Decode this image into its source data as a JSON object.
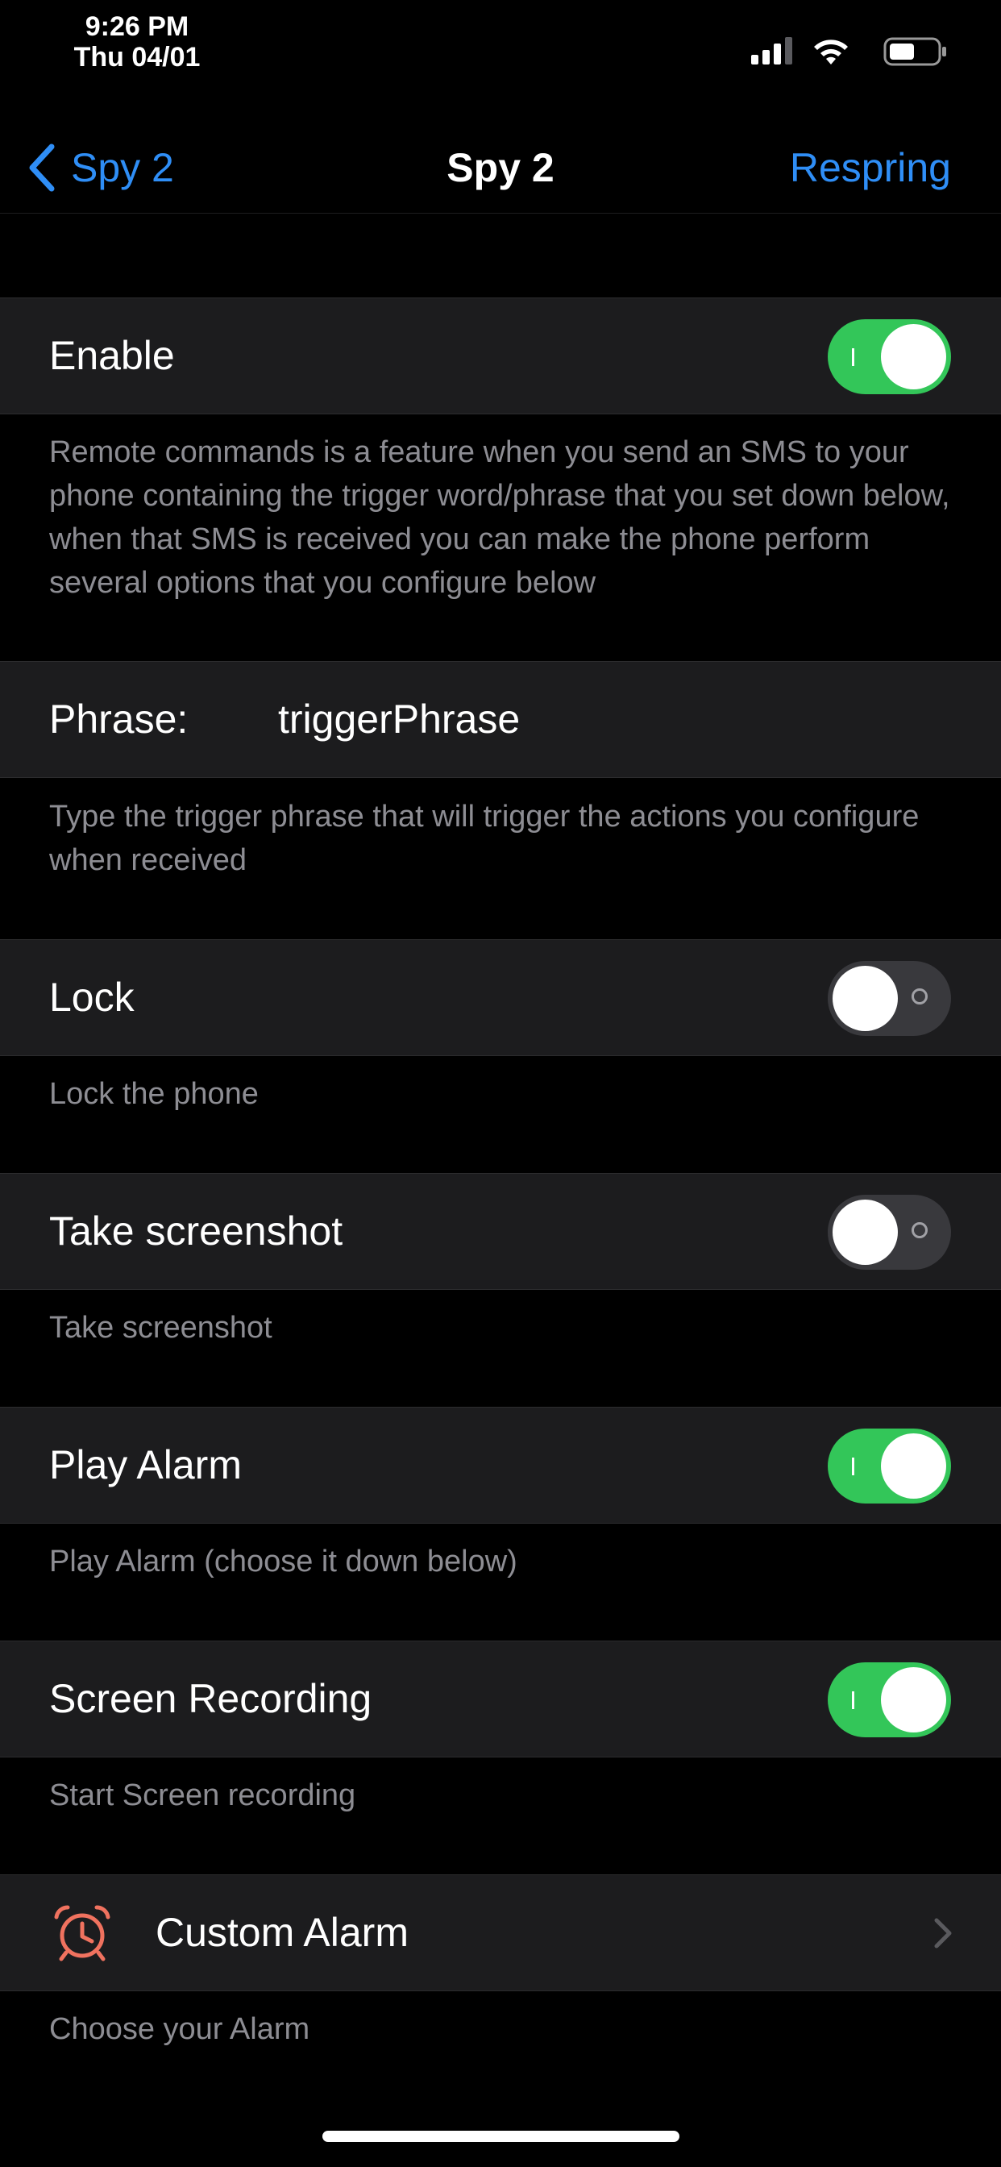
{
  "status_bar": {
    "time": "9:26 PM",
    "date": "Thu 04/01"
  },
  "nav": {
    "back_label": "Spy 2",
    "title": "Spy 2",
    "right_action": "Respring"
  },
  "colors": {
    "accent": "#2f8ef6",
    "switch_on": "#33c659",
    "switch_off": "#39393d",
    "cell_bg": "#1c1c1e",
    "footer_text": "#8d8d93",
    "alarm_icon": "#f0725f"
  },
  "settings": {
    "enable": {
      "label": "Enable",
      "on": true,
      "footer": "Remote commands is a feature when you send an SMS to your phone containing the trigger word/phrase that you set down below, when that SMS is received you can make the phone perform several options that you configure below"
    },
    "phrase": {
      "label": "Phrase:",
      "value": "triggerPhrase",
      "footer": "Type the trigger phrase that will trigger the actions you configure when received"
    },
    "lock": {
      "label": "Lock",
      "on": false,
      "footer": "Lock the phone"
    },
    "screenshot": {
      "label": "Take screenshot",
      "on": false,
      "footer": "Take screenshot"
    },
    "play_alarm": {
      "label": "Play Alarm",
      "on": true,
      "footer": "Play Alarm (choose it down below)"
    },
    "screen_recording": {
      "label": "Screen Recording",
      "on": true,
      "footer": "Start Screen recording"
    },
    "custom_alarm": {
      "label": "Custom Alarm",
      "icon": "alarm-clock-icon",
      "footer": "Choose your Alarm"
    }
  }
}
